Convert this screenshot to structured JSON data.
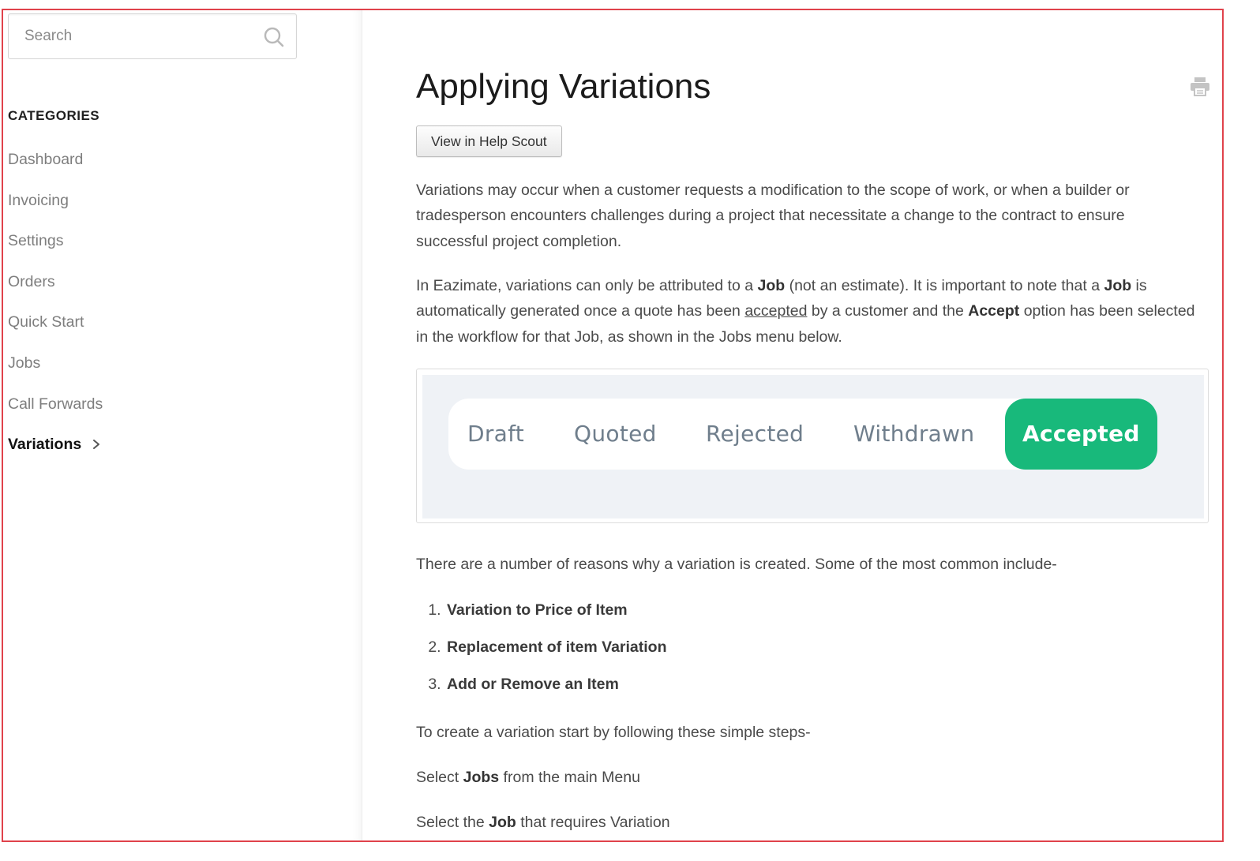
{
  "search": {
    "placeholder": "Search"
  },
  "sidebar": {
    "heading": "CATEGORIES",
    "items": [
      {
        "label": "Dashboard"
      },
      {
        "label": "Invoicing"
      },
      {
        "label": "Settings"
      },
      {
        "label": "Orders"
      },
      {
        "label": "Quick Start"
      },
      {
        "label": "Jobs"
      },
      {
        "label": "Call Forwards"
      },
      {
        "label": "Variations",
        "active": true
      }
    ]
  },
  "article": {
    "title": "Applying Variations",
    "view_button": "View in Help Scout",
    "para1": "Variations may occur when a customer requests a modification to the scope of work, or when a builder or tradesperson encounters challenges during a project that necessitate a change to the contract to ensure successful project completion.",
    "para2": {
      "t1": "In Eazimate, variations can only be attributed to a ",
      "b1": "Job",
      "t2": " (not an estimate). It is important to note that a ",
      "b2": "Job",
      "t3": " is automatically generated once a quote has been ",
      "u1": "accepted",
      "t4": " by a customer and the ",
      "b3": "Accept",
      "t5": " option has been selected in the workflow for that Job, as shown in the Jobs menu below."
    },
    "workflow_image": {
      "items": [
        "Draft",
        "Quoted",
        "Rejected",
        "Withdrawn",
        "Accepted"
      ],
      "active": "Accepted",
      "accent_color": "#18b97b"
    },
    "para3": "There are a number of reasons why a variation is created. Some of the most common include-",
    "reasons": [
      "Variation to Price of Item",
      "Replacement of item Variation",
      "Add or Remove an Item"
    ],
    "para4": "To create a variation start by following these simple steps-",
    "step1": {
      "t1": "Select ",
      "b1": "Jobs",
      "t2": " from the main Menu"
    },
    "step2": {
      "t1": "Select the ",
      "b1": "Job",
      "t2": " that requires Variation"
    }
  },
  "colors": {
    "frame": "#e0424b",
    "accent": "#18b97b"
  }
}
